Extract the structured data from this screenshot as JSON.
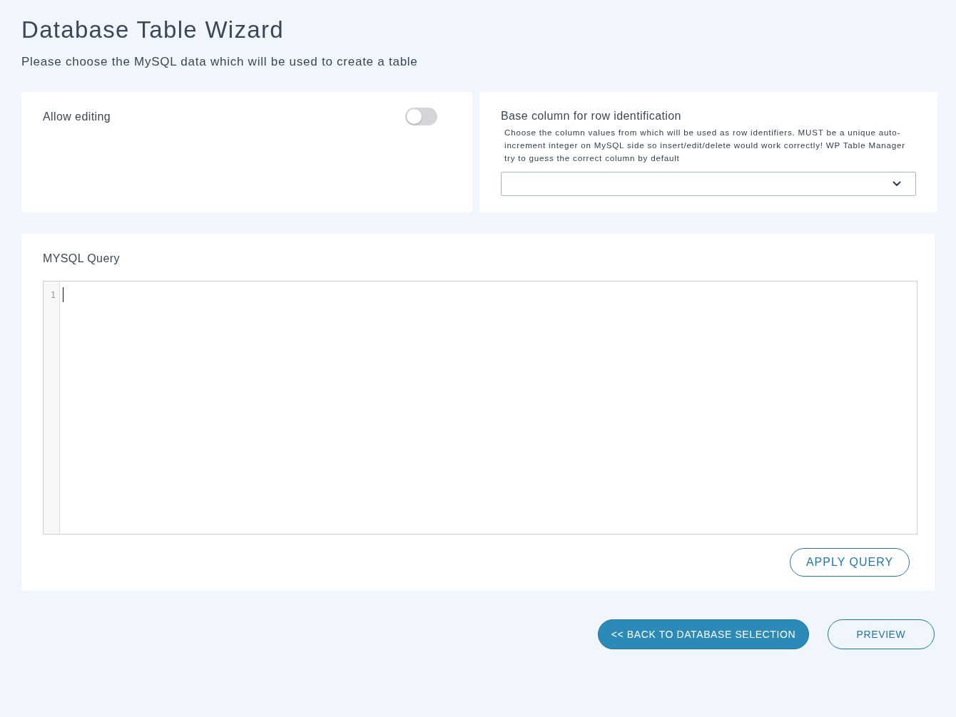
{
  "page": {
    "title": "Database Table Wizard",
    "subtitle": "Please choose the MySQL data which will be used to create a table"
  },
  "editing_card": {
    "label": "Allow editing",
    "toggle": {
      "on": false
    }
  },
  "base_column_card": {
    "label": "Base column for row identification",
    "help": "Choose the column values from which will be used as row identifiers. MUST be a unique auto-increment integer on MySQL side so insert/edit/delete would work correctly! WP Table Manager try to guess the correct column by default"
  },
  "query_card": {
    "label": "MYSQL Query",
    "editor": {
      "line_numbers": [
        "1"
      ]
    },
    "button": "APPLY QUERY"
  },
  "footer_buttons": [
    {
      "label": "<< BACK TO DATABASE SELECTION",
      "kind": "primary"
    },
    {
      "label": "PREVIEW",
      "kind": "outline"
    }
  ]
}
